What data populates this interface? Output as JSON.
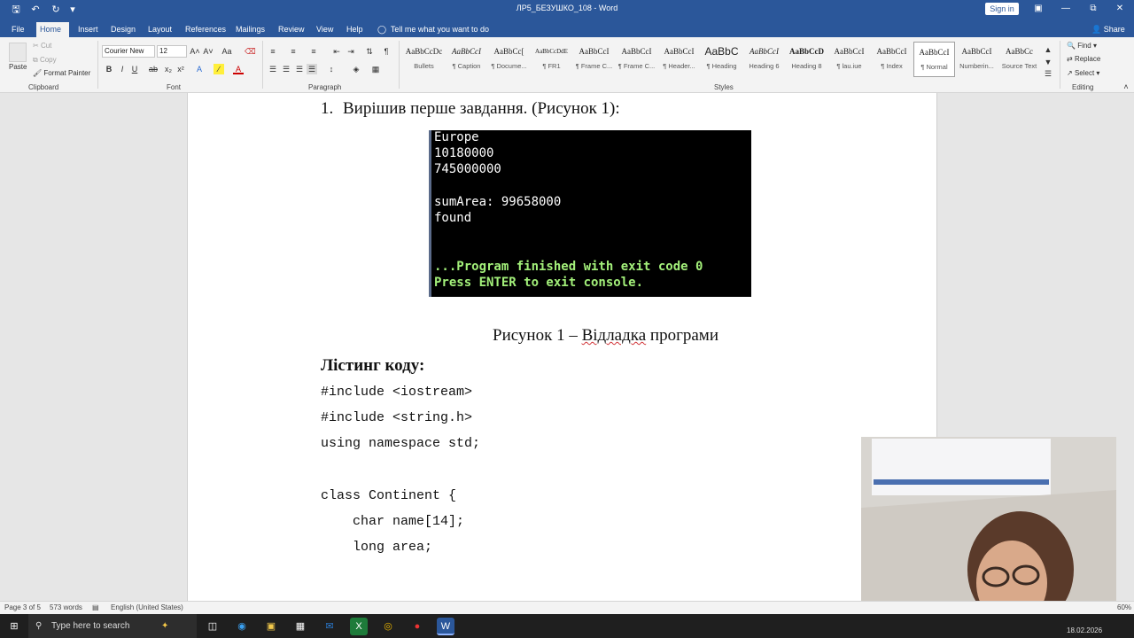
{
  "window": {
    "title": "ЛР5_БЕЗУШКО_108 - Word",
    "sign_in": "Sign in"
  },
  "tabs": [
    {
      "label": "File"
    },
    {
      "label": "Home"
    },
    {
      "label": "Insert"
    },
    {
      "label": "Design"
    },
    {
      "label": "Layout"
    },
    {
      "label": "References"
    },
    {
      "label": "Mailings"
    },
    {
      "label": "Review"
    },
    {
      "label": "View"
    },
    {
      "label": "Help"
    }
  ],
  "tell_me": "Tell me what you want to do",
  "share": "Share",
  "ribbon": {
    "clipboard": {
      "label": "Clipboard",
      "paste": "Paste",
      "cut": "Cut",
      "copy": "Copy",
      "format_painter": "Format Painter"
    },
    "font": {
      "label": "Font",
      "family": "Courier New",
      "size": "12"
    },
    "paragraph": {
      "label": "Paragraph"
    },
    "styles": {
      "label": "Styles",
      "items": [
        {
          "preview": "AaBbCcDc",
          "name": "Bullets"
        },
        {
          "preview": "AaBbCcI",
          "name": "¶ Caption"
        },
        {
          "preview": "AaBbCc[",
          "name": "¶ Docume..."
        },
        {
          "preview": "AaBbCcDdE",
          "name": "¶ FR1"
        },
        {
          "preview": "AaBbCcI",
          "name": "¶ Frame C..."
        },
        {
          "preview": "AaBbCcI",
          "name": "¶ Frame C..."
        },
        {
          "preview": "AaBbCcI",
          "name": "¶ Header..."
        },
        {
          "preview": "AaBbC",
          "name": "¶ Heading"
        },
        {
          "preview": "AaBbCcI",
          "name": "Heading 6"
        },
        {
          "preview": "AaBbCcD",
          "name": "Heading 8"
        },
        {
          "preview": "AaBbCcI",
          "name": "¶ lau.iue"
        },
        {
          "preview": "AaBbCcI",
          "name": "¶ Index"
        },
        {
          "preview": "AaBbCcI",
          "name": "¶ Normal"
        },
        {
          "preview": "AaBbCcI",
          "name": "Numberin..."
        },
        {
          "preview": "AaBbCc",
          "name": "Source Text"
        }
      ]
    },
    "editing": {
      "label": "Editing",
      "find": "Find",
      "replace": "Replace",
      "select": "Select"
    }
  },
  "document": {
    "list_number": "1.",
    "list_text": "Вирішив перше завдання. (Рисунок 1):",
    "console_lines": [
      "Europe",
      "10180000",
      "745000000",
      "",
      "sumArea: 99658000",
      "found",
      "",
      "",
      "...Program finished with exit code 0",
      "Press ENTER to exit console."
    ],
    "caption_prefix": "Рисунок 1 – ",
    "caption_word": "Відладка",
    "caption_suffix": " програми",
    "listing_heading": "Лістинг коду:",
    "code_lines": [
      "#include <iostream>",
      "#include <string.h>",
      "using namespace std;",
      "",
      "class Continent {",
      "    char name[14];",
      "    long area;"
    ]
  },
  "status_bar": {
    "page": "Page 3 of 5",
    "words": "573 words",
    "language": "English (United States)",
    "zoom": "60%"
  },
  "taskbar": {
    "search_placeholder": "Type here to search",
    "date": "18.02.2026"
  }
}
